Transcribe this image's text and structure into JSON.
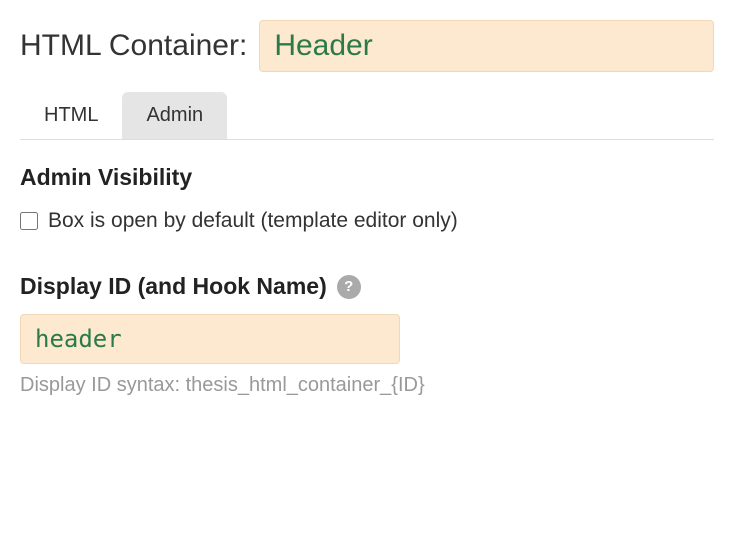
{
  "header": {
    "label": "HTML Container:",
    "value": "Header"
  },
  "tabs": {
    "html": "HTML",
    "admin": "Admin"
  },
  "admin_visibility": {
    "heading": "Admin Visibility",
    "checkbox_label": "Box is open by default (template editor only)",
    "checked": false
  },
  "display_id": {
    "heading": "Display ID (and Hook Name)",
    "value": "header",
    "syntax_hint": "Display ID syntax: thesis_html_container_{ID}"
  }
}
